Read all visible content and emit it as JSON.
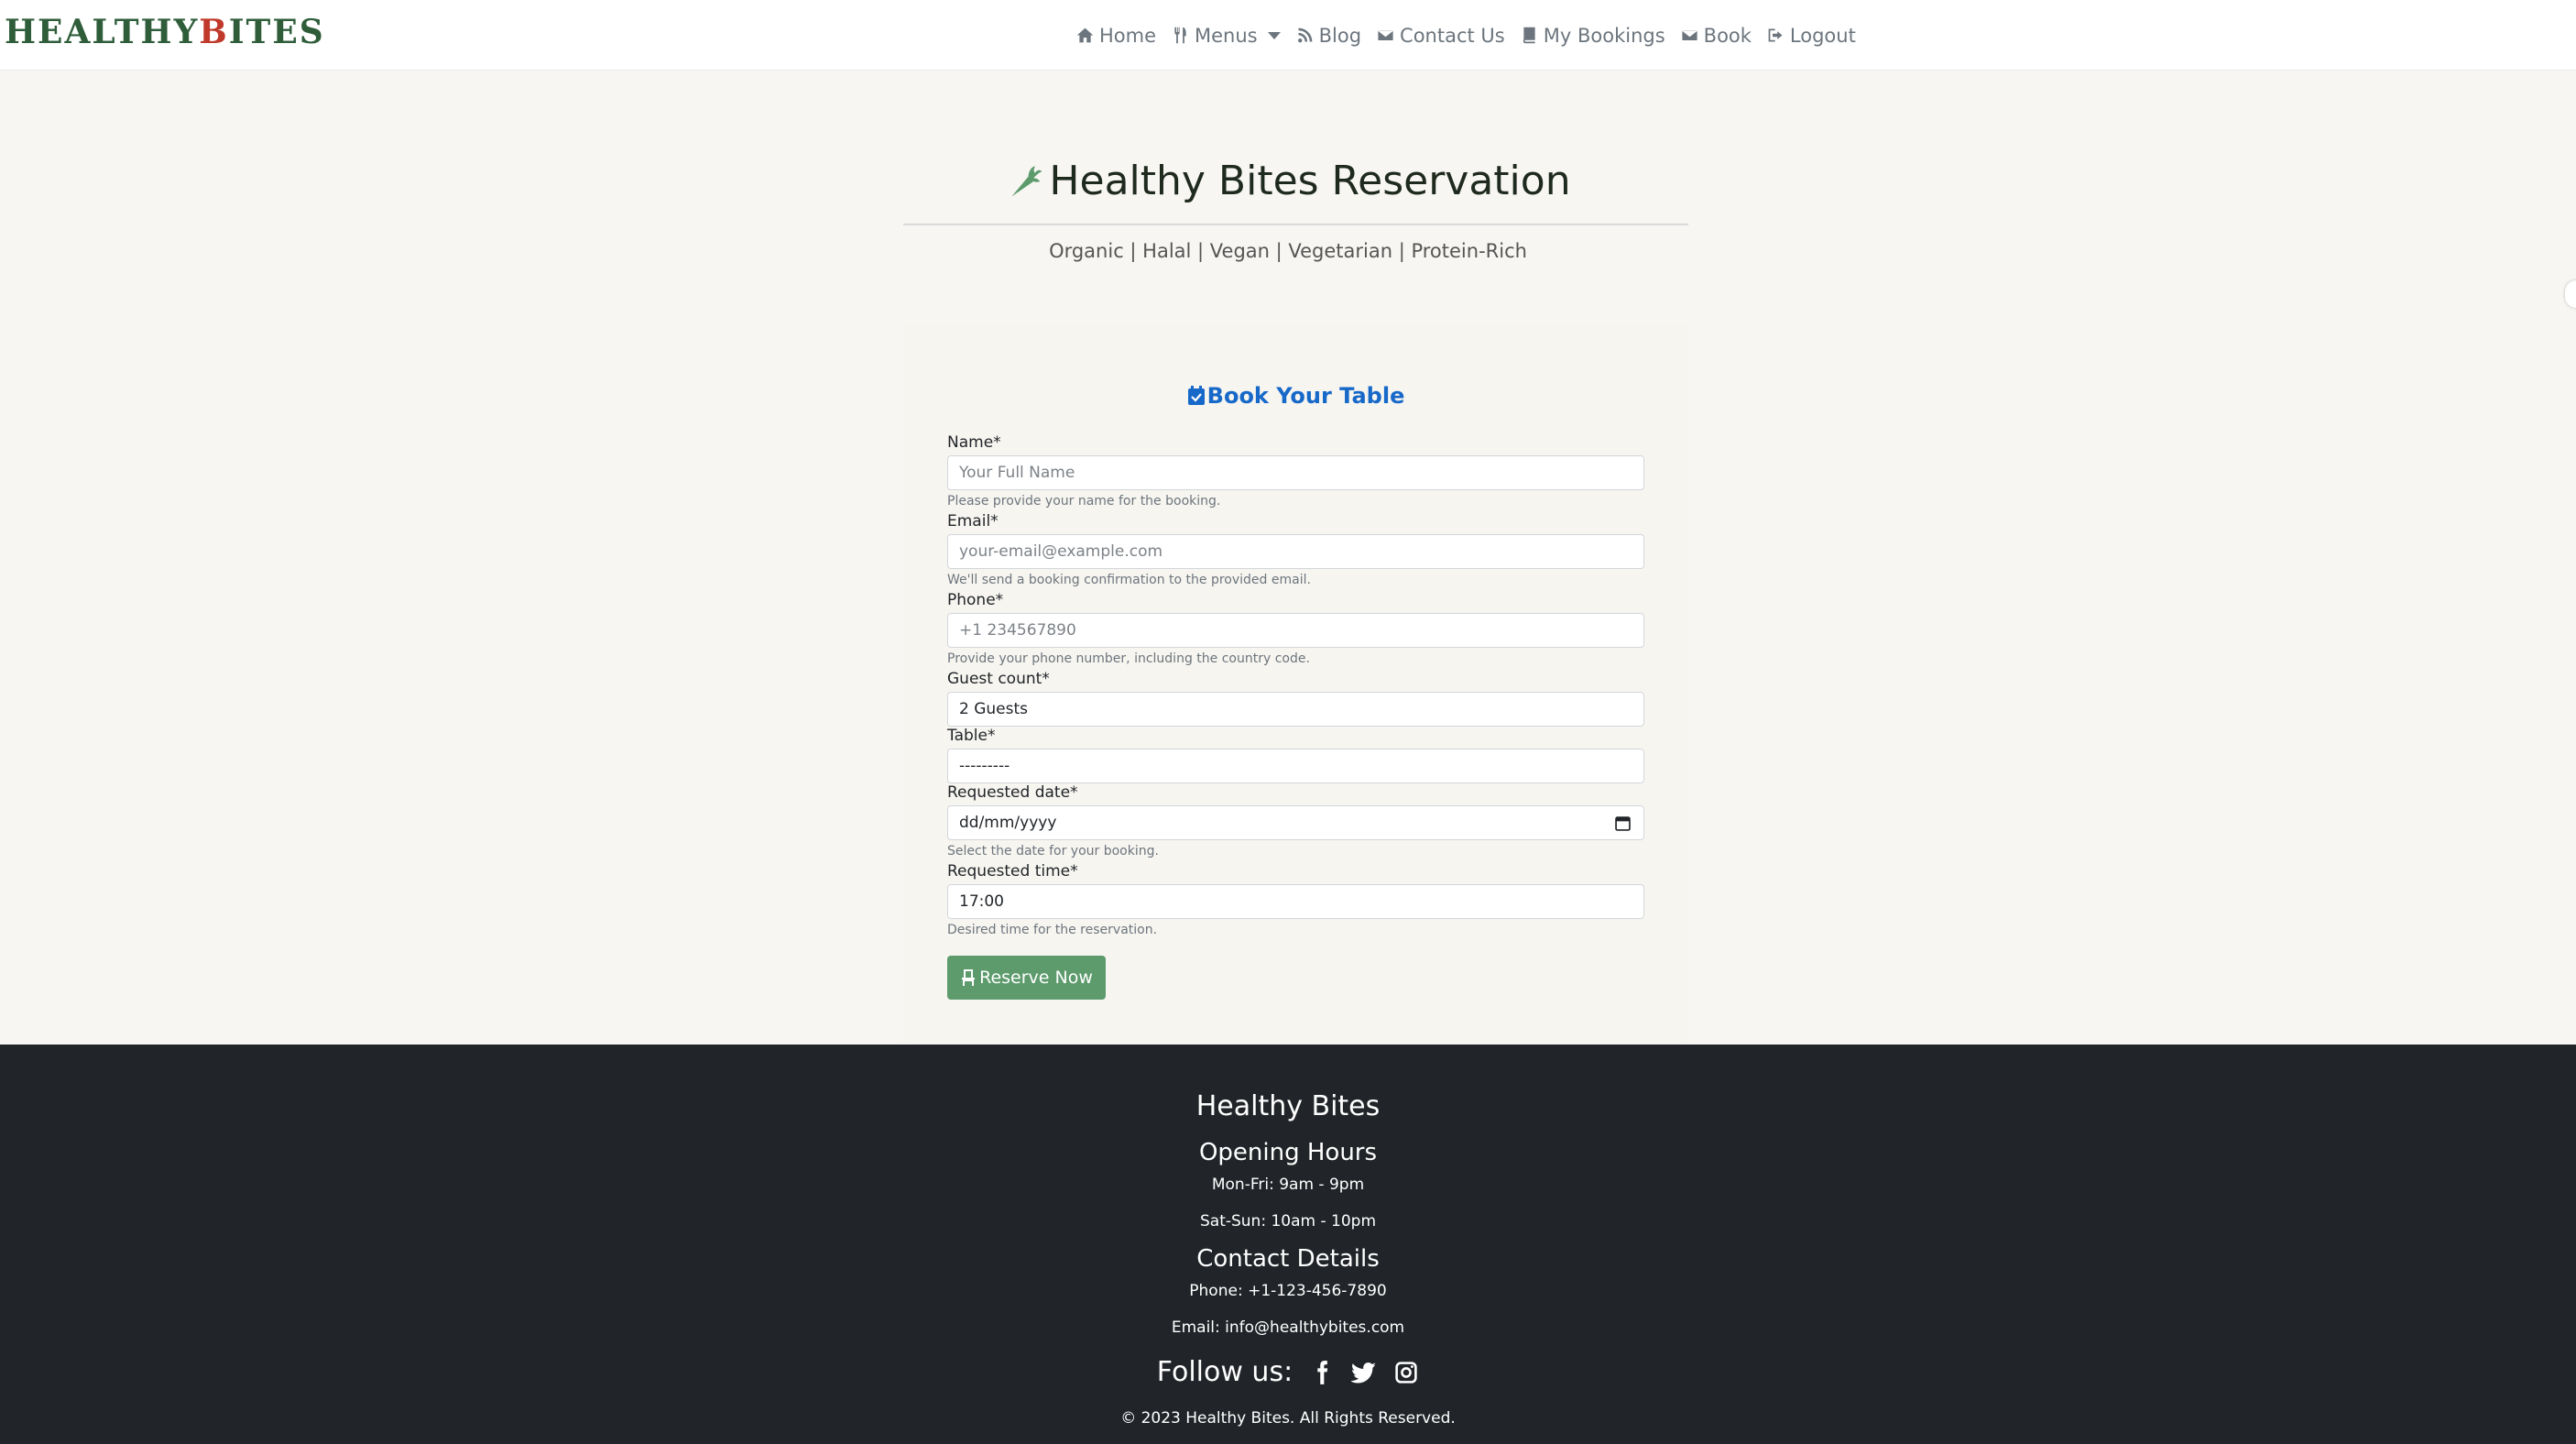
{
  "brand": {
    "part1": "HEALTHY",
    "accent": "B",
    "part2": "ITES"
  },
  "nav": {
    "home": "Home",
    "menus": "Menus",
    "blog": "Blog",
    "contact": "Contact Us",
    "bookings": "My Bookings",
    "book": "Book",
    "logout": "Logout"
  },
  "header": {
    "title": "Healthy Bites Reservation",
    "tagline": "Organic | Halal | Vegan | Vegetarian | Protein-Rich"
  },
  "form": {
    "title": "Book Your Table",
    "name_label": "Name*",
    "name_placeholder": "Your Full Name",
    "name_help": "Please provide your name for the booking.",
    "email_label": "Email*",
    "email_placeholder": "your-email@example.com",
    "email_help": "We'll send a booking confirmation to the provided email.",
    "phone_label": "Phone*",
    "phone_placeholder": "+1 234567890",
    "phone_help": "Provide your phone number, including the country code.",
    "guests_label": "Guest count*",
    "guests_value": "2 Guests",
    "table_label": "Table*",
    "table_value": "---------",
    "date_label": "Requested date*",
    "date_value": "dd/mm/yyyy",
    "date_help": "Select the date for your booking.",
    "time_label": "Requested time*",
    "time_value": "17:00",
    "time_help": "Desired time for the reservation.",
    "submit": "Reserve Now"
  },
  "footer": {
    "name": "Healthy Bites",
    "hours_heading": "Opening Hours",
    "hours_weekday": "Mon-Fri: 9am - 9pm",
    "hours_weekend": "Sat-Sun: 10am - 10pm",
    "contact_heading": "Contact Details",
    "phone": "Phone: +1-123-456-7890",
    "email": "Email: info@healthybites.com",
    "follow": "Follow us:",
    "copyright": "© 2023 Healthy Bites. All Rights Reserved."
  },
  "colors": {
    "brand_green": "#2f5d3a",
    "brand_accent": "#c0392b",
    "link_blue": "#1769c9",
    "button_green": "#5d9b6d",
    "footer_bg": "#212529",
    "page_bg": "#f8f6f2"
  },
  "icons": [
    "home-icon",
    "utensils-icon",
    "blog-icon",
    "envelope-icon",
    "book-icon",
    "envelope-icon",
    "logout-icon",
    "carrot-icon",
    "calendar-check-icon",
    "calendar-icon",
    "chair-icon",
    "facebook-icon",
    "twitter-icon",
    "instagram-icon"
  ]
}
